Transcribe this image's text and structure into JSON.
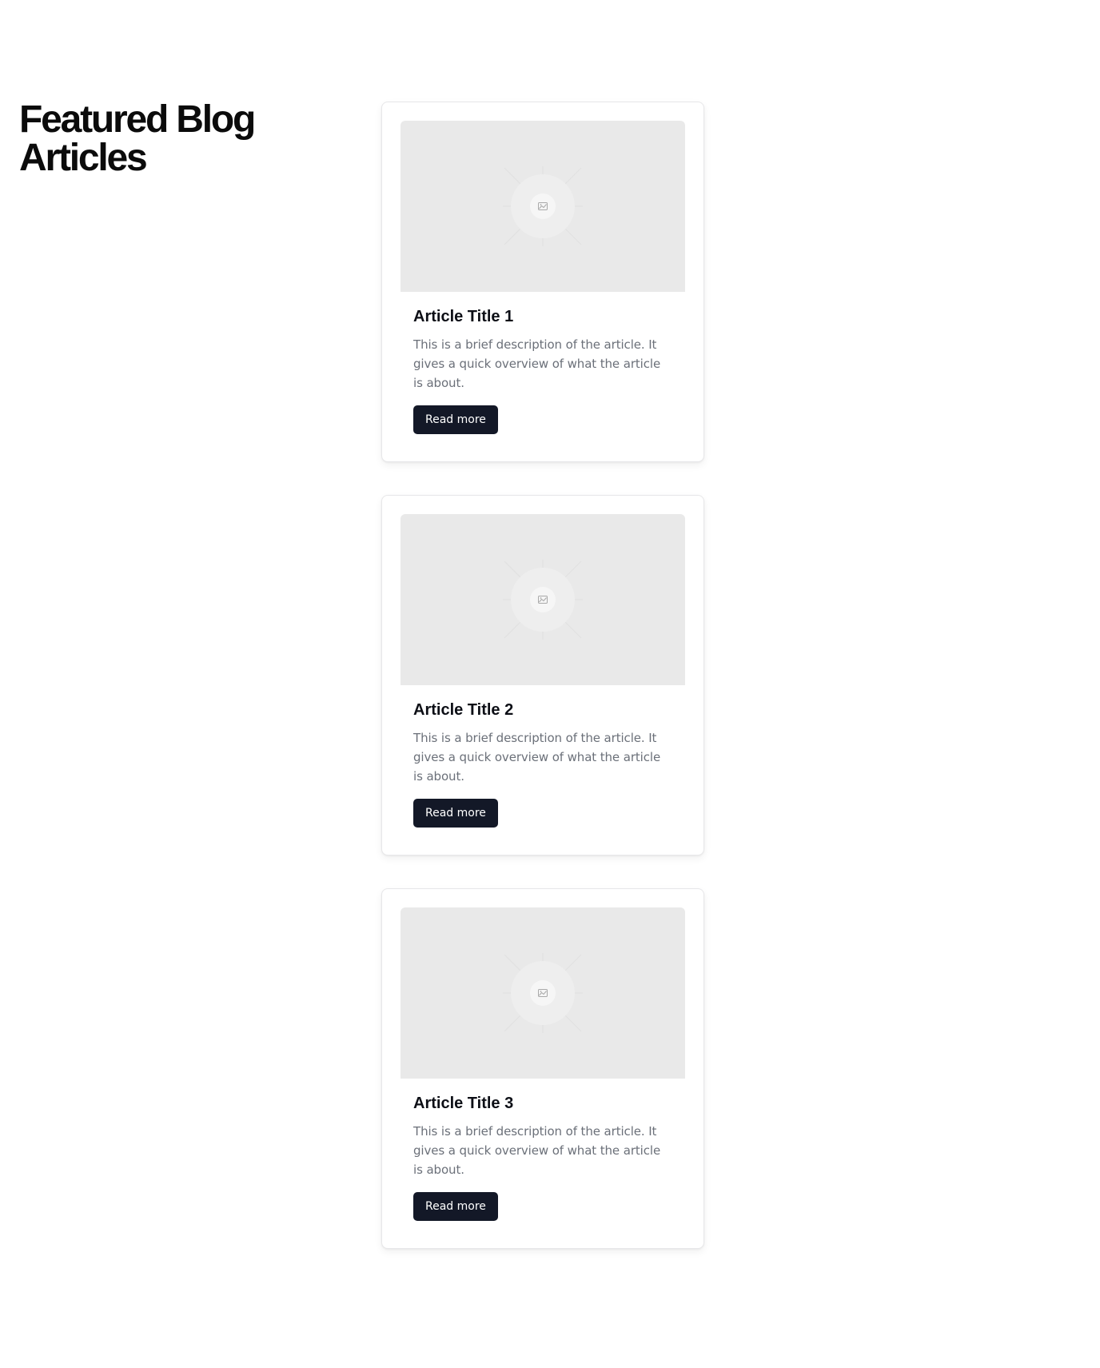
{
  "header": {
    "title": "Featured Blog Articles"
  },
  "articles": [
    {
      "title": "Article Title 1",
      "description": "This is a brief description of the article. It gives a quick overview of what the article is about.",
      "button_label": "Read more",
      "image_icon": "image-placeholder-icon"
    },
    {
      "title": "Article Title 2",
      "description": "This is a brief description of the article. It gives a quick overview of what the article is about.",
      "button_label": "Read more",
      "image_icon": "image-placeholder-icon"
    },
    {
      "title": "Article Title 3",
      "description": "This is a brief description of the article. It gives a quick overview of what the article is about.",
      "button_label": "Read more",
      "image_icon": "image-placeholder-icon"
    }
  ],
  "colors": {
    "button_bg": "#131827",
    "title_text": "#0d0f16",
    "body_text": "#6b7079",
    "placeholder_bg": "#e9e9e9"
  }
}
